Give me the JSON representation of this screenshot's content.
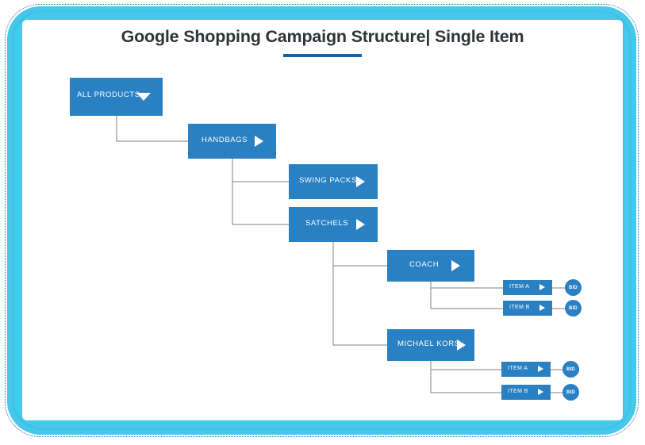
{
  "frame": {
    "accent_color": "#45c8ea",
    "outline_color": "#2b6fb5",
    "card_color": "#ffffff"
  },
  "header": {
    "title": "Google Shopping Campaign Structure|  Single Item",
    "rule_color": "#1163a8"
  },
  "theme": {
    "node_color": "#2980c2",
    "node_text_color": "#ffffff",
    "connector_color": "#808080"
  },
  "diagram": {
    "nodes": {
      "all_products": {
        "label": "ALL PRODUCTS",
        "icon": "chevron-down-icon"
      },
      "handbags": {
        "label": "HANDBAGS",
        "icon": "chevron-right-icon"
      },
      "swing_packs": {
        "label": "SWING PACKS",
        "icon": "chevron-right-icon"
      },
      "satchels": {
        "label": "SATCHELS",
        "icon": "chevron-right-icon"
      },
      "coach": {
        "label": "COACH",
        "icon": "chevron-right-icon"
      },
      "michael_kors": {
        "label": "MICHAEL KORS",
        "icon": "chevron-right-icon"
      },
      "coach_item_a": {
        "label": "ITEM A",
        "icon": "chevron-right-icon"
      },
      "coach_item_b": {
        "label": "ITEM B",
        "icon": "chevron-right-icon"
      },
      "mk_item_a": {
        "label": "ITEM A",
        "icon": "chevron-right-icon"
      },
      "mk_item_b": {
        "label": "ITEM B",
        "icon": "chevron-right-icon"
      },
      "bid_coach_a": {
        "label": "BID"
      },
      "bid_coach_b": {
        "label": "BID"
      },
      "bid_mk_a": {
        "label": "BID"
      },
      "bid_mk_b": {
        "label": "BID"
      }
    }
  }
}
